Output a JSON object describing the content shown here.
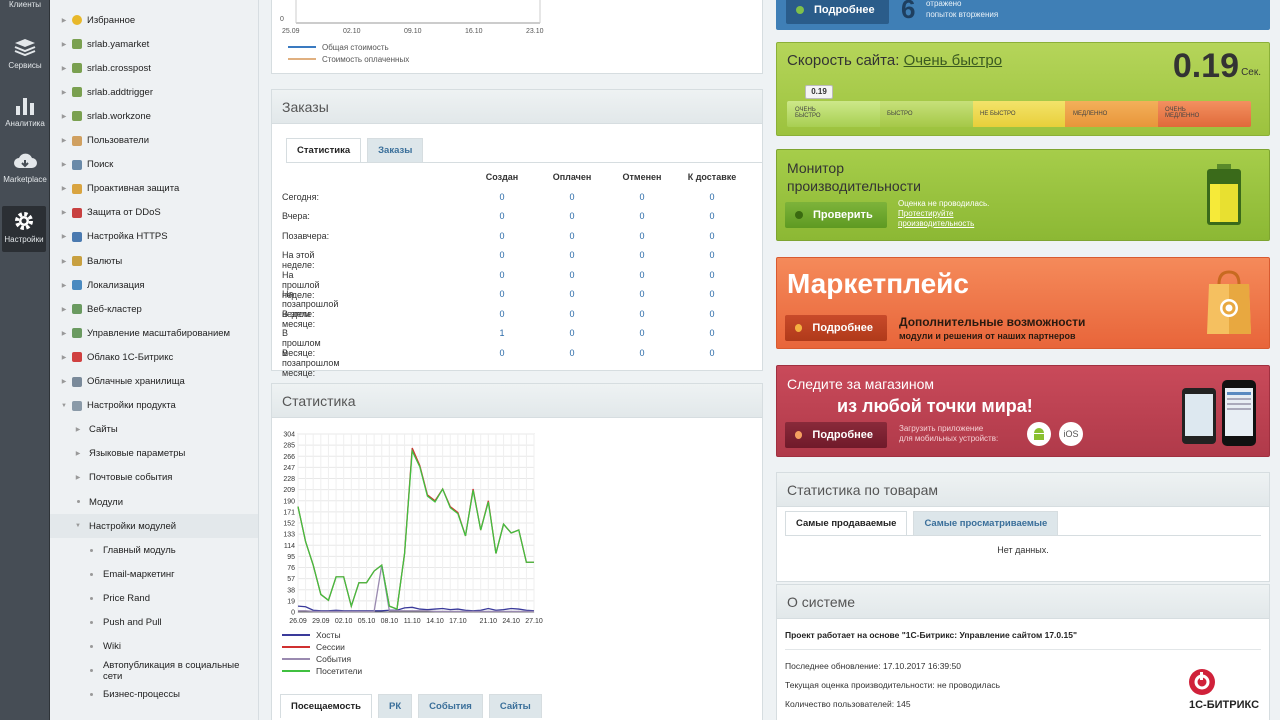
{
  "rail": [
    {
      "label": "Клиенты",
      "icon": "clients-icon"
    },
    {
      "label": "Сервисы",
      "icon": "services-icon"
    },
    {
      "label": "Аналитика",
      "icon": "analytics-icon"
    },
    {
      "label": "Marketplace",
      "icon": "marketplace-icon"
    },
    {
      "label": "Настройки",
      "icon": "settings-icon"
    }
  ],
  "menu": [
    {
      "label": "Избранное",
      "icon": "star-icon",
      "color": "#e8b82a"
    },
    {
      "label": "srlab.yamarket",
      "icon": "module-icon",
      "color": "#7aa050"
    },
    {
      "label": "srlab.crosspost",
      "icon": "module-icon",
      "color": "#7aa050"
    },
    {
      "label": "srlab.addtrigger",
      "icon": "module-icon",
      "color": "#7aa050"
    },
    {
      "label": "srlab.workzone",
      "icon": "module-icon",
      "color": "#7aa050"
    },
    {
      "label": "Пользователи",
      "icon": "users-icon",
      "color": "#d0a060"
    },
    {
      "label": "Поиск",
      "icon": "search-icon",
      "color": "#6a8aa8"
    },
    {
      "label": "Проактивная защита",
      "icon": "lock-icon",
      "color": "#d9a440"
    },
    {
      "label": "Защита от DDoS",
      "icon": "shield-icon",
      "color": "#c84040"
    },
    {
      "label": "Настройка HTTPS",
      "icon": "https-icon",
      "color": "#4a7ab0"
    },
    {
      "label": "Валюты",
      "icon": "currency-icon",
      "color": "#c8a040"
    },
    {
      "label": "Локализация",
      "icon": "globe-icon",
      "color": "#4a8ac0"
    },
    {
      "label": "Веб-кластер",
      "icon": "cluster-icon",
      "color": "#6a9a60"
    },
    {
      "label": "Управление масштабированием",
      "icon": "scale-icon",
      "color": "#6a9a60"
    },
    {
      "label": "Облако 1С-Битрикс",
      "icon": "cloud-icon",
      "color": "#d04040"
    },
    {
      "label": "Облачные хранилища",
      "icon": "storage-icon",
      "color": "#7a8a9a"
    },
    {
      "label": "Настройки продукта",
      "icon": "gear-icon",
      "color": "#8a9aa8"
    },
    {
      "label": "Сайты",
      "sub": 1
    },
    {
      "label": "Языковые параметры",
      "sub": 1
    },
    {
      "label": "Почтовые события",
      "sub": 1
    },
    {
      "label": "Модули",
      "sub": 1
    },
    {
      "label": "Настройки модулей",
      "sub": 1
    },
    {
      "label": "Главный модуль",
      "sub": 2
    },
    {
      "label": "Email-маркетинг",
      "sub": 2
    },
    {
      "label": "Price Rand",
      "sub": 2
    },
    {
      "label": "Push and Pull",
      "sub": 2
    },
    {
      "label": "Wiki",
      "sub": 2
    },
    {
      "label": "Автопубликация в социальные сети",
      "sub": 2
    },
    {
      "label": "Бизнес-процессы",
      "sub": 2
    }
  ],
  "top_chart": {
    "x_ticks": [
      "25.09",
      "02.10",
      "09.10",
      "16.10",
      "23.10"
    ],
    "y_tick": "0",
    "legend": [
      {
        "label": "Общая стоимость",
        "color": "#3a7ac0"
      },
      {
        "label": "Стоимость оплаченных",
        "color": "#e0b080"
      }
    ]
  },
  "orders": {
    "title": "Заказы",
    "tabs": [
      "Статистика",
      "Заказы"
    ],
    "columns": [
      "Создан",
      "Оплачен",
      "Отменен",
      "К доставке"
    ],
    "rows": [
      {
        "label": "Сегодня:",
        "values": [
          "0",
          "0",
          "0",
          "0"
        ]
      },
      {
        "label": "Вчера:",
        "values": [
          "0",
          "0",
          "0",
          "0"
        ]
      },
      {
        "label": "Позавчера:",
        "values": [
          "0",
          "0",
          "0",
          "0"
        ]
      },
      {
        "label": "На этой неделе:",
        "values": [
          "0",
          "0",
          "0",
          "0"
        ]
      },
      {
        "label": "На прошлой неделе:",
        "values": [
          "0",
          "0",
          "0",
          "0"
        ]
      },
      {
        "label": "На позапрошлой неделе:",
        "values": [
          "0",
          "0",
          "0",
          "0"
        ]
      },
      {
        "label": "В этом месяце:",
        "values": [
          "0",
          "0",
          "0",
          "0"
        ]
      },
      {
        "label": "В прошлом месяце:",
        "values": [
          "1",
          "0",
          "0",
          "0"
        ]
      },
      {
        "label": "В позапрошлом месяце:",
        "values": [
          "0",
          "0",
          "0",
          "0"
        ]
      }
    ]
  },
  "stats": {
    "title": "Статистика",
    "tabs": [
      "Посещаемость",
      "РК",
      "События",
      "Сайты"
    ]
  },
  "chart_data": {
    "type": "line",
    "x": [
      "26.09",
      "27.09",
      "28.09",
      "29.09",
      "30.09",
      "01.10",
      "02.10",
      "03.10",
      "04.10",
      "05.10",
      "06.10",
      "07.10",
      "08.10",
      "09.10",
      "10.10",
      "11.10",
      "12.10",
      "13.10",
      "14.10",
      "15.10",
      "16.10",
      "17.10",
      "18.10",
      "19.10",
      "20.10",
      "21.10",
      "22.10",
      "23.10",
      "24.10",
      "25.10",
      "26.10",
      "27.10"
    ],
    "x_ticks": [
      "26.09",
      "29.09",
      "02.10",
      "05.10",
      "08.10",
      "11.10",
      "14.10",
      "17.10",
      "21.10",
      "24.10",
      "27.10"
    ],
    "y_ticks": [
      "304",
      "285",
      "266",
      "247",
      "228",
      "209",
      "190",
      "171",
      "152",
      "133",
      "114",
      "95",
      "76",
      "57",
      "38",
      "19",
      "0"
    ],
    "ylim": [
      0,
      304
    ],
    "grid": true,
    "legend_position": "bottom",
    "series": [
      {
        "name": "Хосты",
        "color": "#3a3a9a",
        "values": [
          10,
          9,
          3,
          2,
          2,
          3,
          2,
          2,
          2,
          2,
          2,
          2,
          3,
          3,
          7,
          8,
          5,
          4,
          5,
          6,
          4,
          5,
          3,
          2,
          3,
          6,
          3,
          4,
          6,
          5,
          3,
          2
        ]
      },
      {
        "name": "Сессии",
        "color": "#d03030",
        "values": [
          180,
          120,
          80,
          30,
          20,
          60,
          60,
          10,
          50,
          50,
          70,
          80,
          10,
          5,
          100,
          280,
          250,
          200,
          190,
          210,
          180,
          170,
          130,
          210,
          140,
          190,
          100,
          150,
          135,
          140,
          85,
          85
        ]
      },
      {
        "name": "События",
        "color": "#9a8ab0",
        "values": [
          2,
          2,
          1,
          1,
          1,
          1,
          1,
          1,
          1,
          1,
          1,
          80,
          2,
          2,
          2,
          2,
          2,
          2,
          1,
          1,
          1,
          1,
          1,
          1,
          1,
          1,
          1,
          1,
          1,
          1,
          1,
          1
        ]
      },
      {
        "name": "Посетители",
        "color": "#40c040",
        "values": [
          180,
          120,
          80,
          30,
          20,
          60,
          60,
          10,
          50,
          50,
          70,
          80,
          10,
          5,
          100,
          275,
          248,
          198,
          188,
          210,
          178,
          168,
          130,
          208,
          140,
          188,
          100,
          150,
          135,
          140,
          85,
          85
        ]
      }
    ]
  },
  "widgets": {
    "security": {
      "button": "Подробнее",
      "count": "6",
      "text1": "отражено",
      "text2": "попыток вторжения"
    },
    "speed": {
      "title": "Скорость сайта:",
      "value_text": "Очень быстро",
      "seconds": "0.19",
      "unit": "Сек.",
      "marker": "0.19",
      "scale": [
        "ОЧЕНЬ БЫСТРО",
        "БЫСТРО",
        "НЕ БЫСТРО",
        "МЕДЛЕННО",
        "ОЧЕНЬ МЕДЛЕННО"
      ]
    },
    "monitor": {
      "title1": "Монитор",
      "title2": "производительности",
      "button": "Проверить",
      "note": "Оценка не проводилась.",
      "link1": "Протестируйте",
      "link2": "производительность"
    },
    "marketplace": {
      "title": "Маркетплейс",
      "button": "Подробнее",
      "sub1": "Дополнительные возможности",
      "sub2": "модули и решения от наших партнеров"
    },
    "mobile": {
      "line1": "Следите за магазином",
      "line2": "из любой точки мира!",
      "button": "Подробнее",
      "note1": "Загрузить приложение",
      "note2": "для мобильных устройств:",
      "ios": "iOS"
    }
  },
  "goods": {
    "title": "Статистика по товарам",
    "tabs": [
      "Самые продаваемые",
      "Самые просматриваемые"
    ],
    "empty": "Нет данных."
  },
  "system": {
    "title": "О системе",
    "lead": "Проект работает на основе \"1С-Битрикс: Управление сайтом 17.0.15\"",
    "line1": "Последнее обновление: 17.10.2017 16:39:50",
    "line2": "Текущая оценка производительности: не проводилась",
    "line3": "Количество пользователей: 145",
    "logo": "1С-БИТРИКС"
  }
}
